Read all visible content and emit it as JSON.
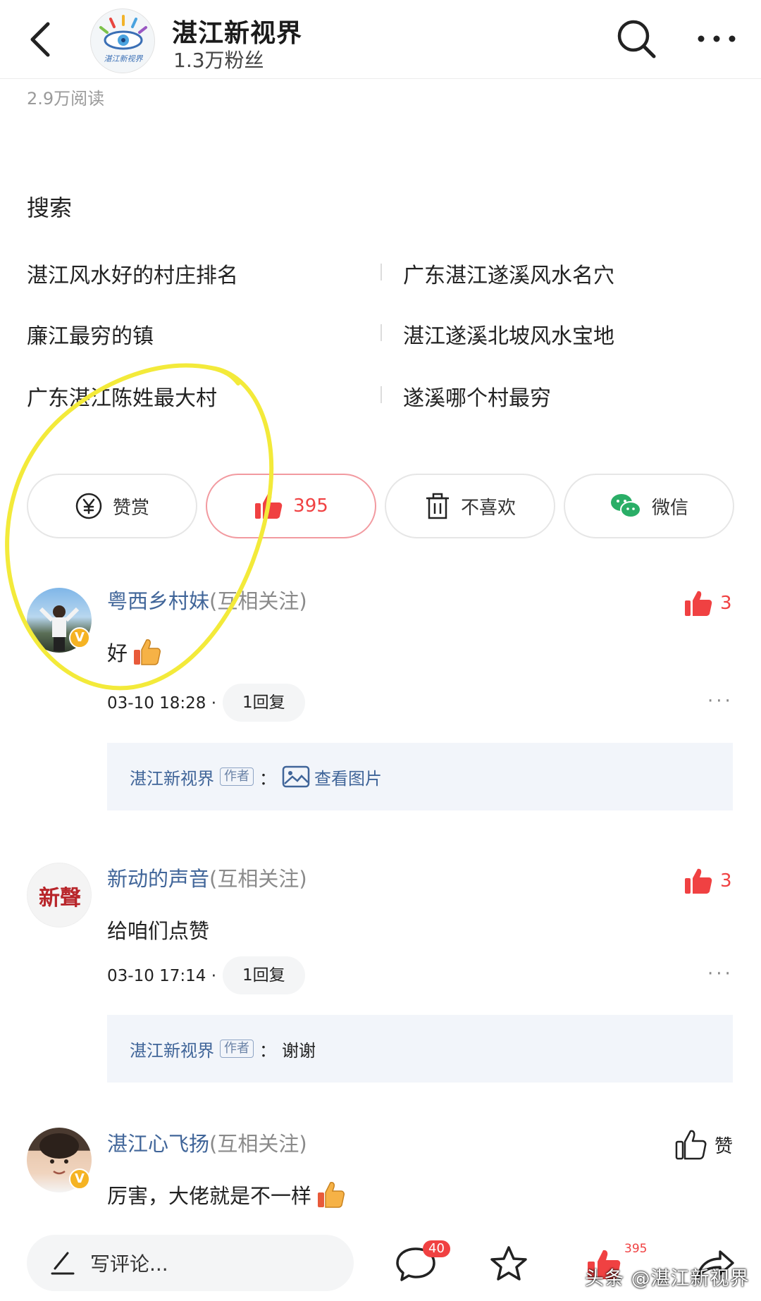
{
  "header": {
    "account_name": "湛江新视界",
    "fans": "1.3万粉丝",
    "logo_text": "湛江新视界"
  },
  "article": {
    "reads": "2.9万阅读"
  },
  "search": {
    "title": "搜索",
    "suggestions": [
      "湛江风水好的村庄排名",
      "广东湛江遂溪风水名穴",
      "廉江最穷的镇",
      "湛江遂溪北坡风水宝地",
      "广东湛江陈姓最大村",
      "遂溪哪个村最穷"
    ]
  },
  "actions": {
    "reward_label": "赞赏",
    "reward_icon": "yen-coin-icon",
    "like_count": "395",
    "dislike_label": "不喜欢",
    "wechat_label": "微信"
  },
  "comments": [
    {
      "name": "粤西乡村妹",
      "relation": "(互相关注)",
      "text": "好",
      "time": "03-10 18:28 ·",
      "replies": "1回复",
      "likes": "3",
      "reply_author": "湛江新视界",
      "author_tag": "作者",
      "reply_colon": "：",
      "reply_content": "查看图片"
    },
    {
      "name": "新动的声音",
      "relation": "(互相关注)",
      "text": "给咱们点赞",
      "time": "03-10 17:14 ·",
      "replies": "1回复",
      "likes": "3",
      "avatar_text": "新聲",
      "reply_author": "湛江新视界",
      "author_tag": "作者",
      "reply_colon": "：",
      "reply_content": "谢谢"
    },
    {
      "name": "湛江心飞扬",
      "relation": "(互相关注)",
      "text": "厉害，大佬就是不一样",
      "like_label": "赞"
    }
  ],
  "bottombar": {
    "input_placeholder": "写评论...",
    "comment_count": "40",
    "like_count": "395",
    "watermark": "头条 @湛江新视界"
  },
  "colors": {
    "accent_red": "#f04142",
    "link_blue": "#406599",
    "annotation_yellow": "#f3ea3a",
    "wechat_green": "#2aae67"
  }
}
